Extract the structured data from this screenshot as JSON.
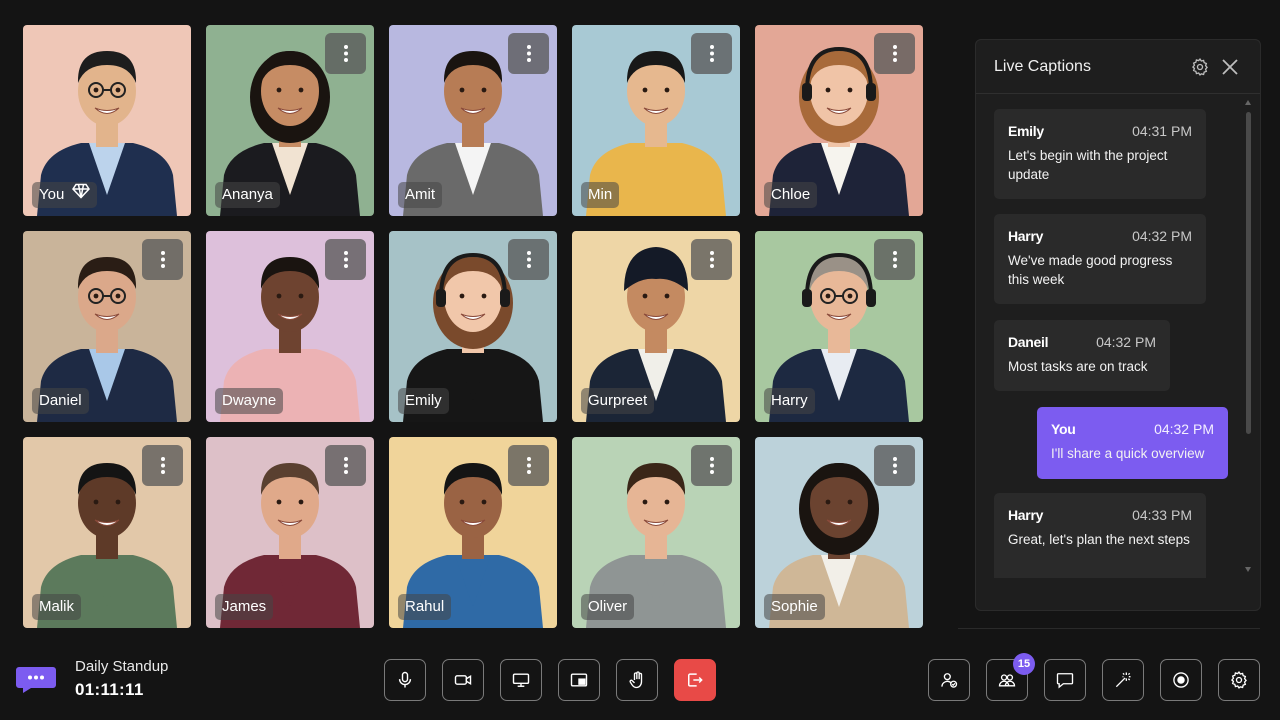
{
  "participants": [
    {
      "name": "You",
      "bg": "#efc7b7",
      "skin": "#e2b48c",
      "hair": "#1d1d1d",
      "suit": "#1f2f4f",
      "shirt": "#bcd3ec",
      "glasses": true,
      "is_self": true,
      "self_icon": "diamond-icon"
    },
    {
      "name": "Ananya",
      "bg": "#8fb191",
      "skin": "#c68c64",
      "hair": "#1a1410",
      "suit": "#1b1b1f",
      "shirt": "#f1e3d2"
    },
    {
      "name": "Amit",
      "bg": "#b8b8e0",
      "skin": "#b77c55",
      "hair": "#1a1410",
      "suit": "#6a6a6a",
      "shirt": "#f4f4f4"
    },
    {
      "name": "Min",
      "bg": "#a8c9d4",
      "skin": "#e6b88f",
      "hair": "#181818",
      "suit": "#e9b64c",
      "shirt": "#e9b64c"
    },
    {
      "name": "Chloe",
      "bg": "#e3a796",
      "skin": "#f0c4a7",
      "hair": "#a86a3a",
      "suit": "#1e2338",
      "shirt": "#f6f4ee",
      "headset": true
    },
    {
      "name": "Daniel",
      "bg": "#c9b49a",
      "skin": "#dba88a",
      "hair": "#2a1d15",
      "suit": "#1e2a44",
      "shirt": "#a9c8e8",
      "glasses": true
    },
    {
      "name": "Dwayne",
      "bg": "#ddc0db",
      "skin": "#6e4330",
      "hair": "#1a1410",
      "suit": "#ecb2b4",
      "shirt": "#ecb2b4"
    },
    {
      "name": "Emily",
      "bg": "#a6c2c7",
      "skin": "#f1c7aa",
      "hair": "#7a4a2c",
      "suit": "#161616",
      "shirt": "#161616",
      "headset": true
    },
    {
      "name": "Gurpreet",
      "bg": "#eed6a6",
      "skin": "#c48a61",
      "hair": "#141a27",
      "suit": "#1b2536",
      "shirt": "#f0efe9",
      "turban": true
    },
    {
      "name": "Harry",
      "bg": "#a8c8a0",
      "skin": "#e8b898",
      "hair": "#9a9187",
      "suit": "#1d2941",
      "shirt": "#e8ecf2",
      "glasses": true,
      "headset": true
    },
    {
      "name": "Malik",
      "bg": "#e2c8a9",
      "skin": "#5e3a28",
      "hair": "#141414",
      "suit": "#5c7a5c",
      "shirt": "#5c7a5c"
    },
    {
      "name": "James",
      "bg": "#ddc0c8",
      "skin": "#e0a98a",
      "hair": "#5a4030",
      "suit": "#702836",
      "shirt": "#702836"
    },
    {
      "name": "Rahul",
      "bg": "#f0d49a",
      "skin": "#9a6344",
      "hair": "#141414",
      "suit": "#2f6aa6",
      "shirt": "#2f6aa6"
    },
    {
      "name": "Oliver",
      "bg": "#b9d3b6",
      "skin": "#e6b595",
      "hair": "#3a2618",
      "suit": "#8f9594",
      "shirt": "#8f9594"
    },
    {
      "name": "Sophie",
      "bg": "#bcd2da",
      "skin": "#6b4330",
      "hair": "#1a1410",
      "suit": "#cfb797",
      "shirt": "#f2efe8"
    }
  ],
  "captions": {
    "title": "Live Captions",
    "settings_icon": "gear-icon",
    "close_icon": "close-icon",
    "messages": [
      {
        "speaker": "Emily",
        "time": "04:31 PM",
        "text": "Let's begin with the project update",
        "mine": false
      },
      {
        "speaker": "Harry",
        "time": "04:32 PM",
        "text": "We've made good progress this week",
        "mine": false
      },
      {
        "speaker": "Daneil",
        "time": "04:32 PM",
        "text": "Most tasks are on track",
        "mine": false
      },
      {
        "speaker": "You",
        "time": "04:32 PM",
        "text": "I'll share a quick overview",
        "mine": true
      },
      {
        "speaker": "Harry",
        "time": "04:33 PM",
        "text": "Great, let's plan the next steps",
        "mine": false
      }
    ]
  },
  "meeting": {
    "title": "Daily Standup",
    "timer": "01:11:11",
    "logo_icon": "chat-bubble-logo-icon"
  },
  "controls": {
    "center": [
      {
        "id": "mic",
        "icon": "microphone-icon"
      },
      {
        "id": "camera",
        "icon": "video-camera-icon"
      },
      {
        "id": "share-screen",
        "icon": "screen-share-icon"
      },
      {
        "id": "pip",
        "icon": "picture-in-picture-icon"
      },
      {
        "id": "raise-hand",
        "icon": "hand-icon"
      },
      {
        "id": "leave",
        "icon": "leave-icon"
      }
    ],
    "right": [
      {
        "id": "admit",
        "icon": "person-check-icon"
      },
      {
        "id": "participants",
        "icon": "participants-icon",
        "badge": "15"
      },
      {
        "id": "chat",
        "icon": "chat-icon"
      },
      {
        "id": "effects",
        "icon": "magic-wand-icon"
      },
      {
        "id": "record",
        "icon": "record-icon"
      },
      {
        "id": "settings",
        "icon": "gear-icon"
      }
    ]
  },
  "colors": {
    "accent": "#7c5cf0",
    "leave": "#e84a47",
    "background": "#141414"
  }
}
